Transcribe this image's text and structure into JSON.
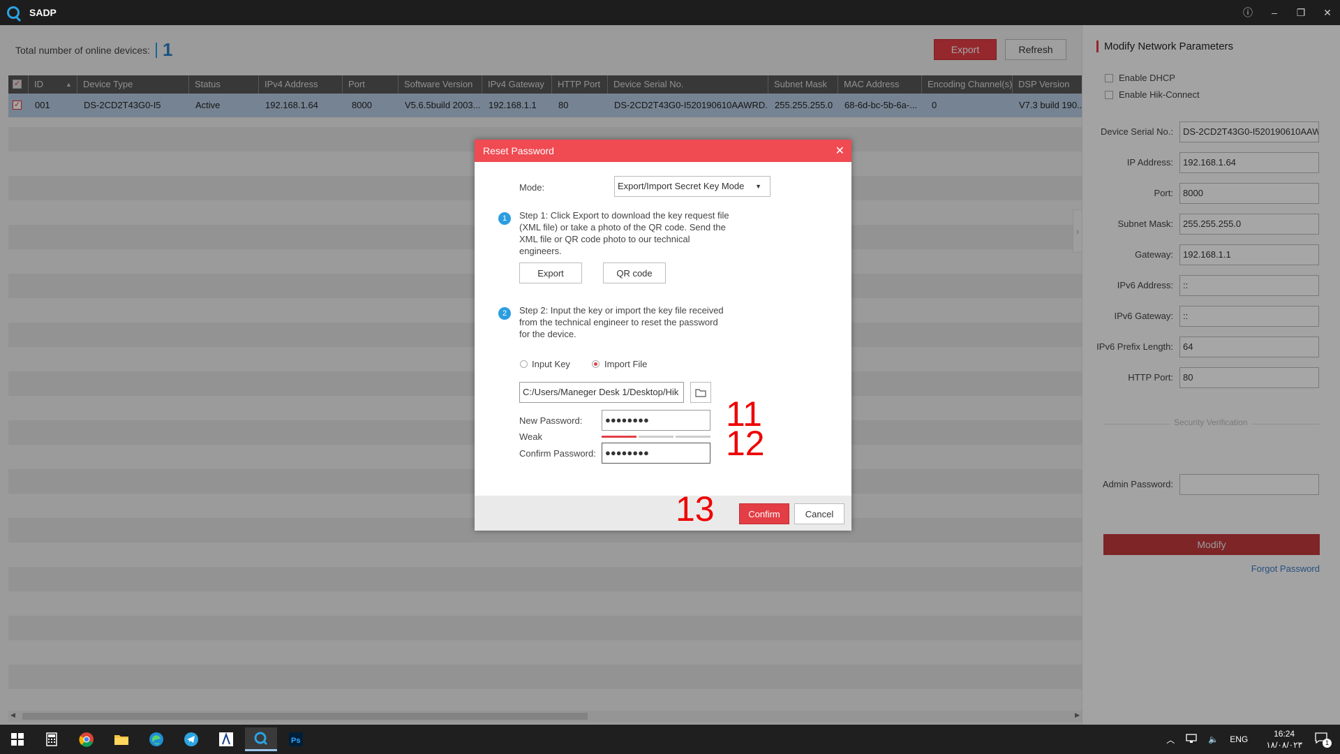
{
  "app": {
    "title": "SADP"
  },
  "window_controls": {
    "info": "ⓘ",
    "minimize": "–",
    "restore": "❐",
    "close": "✕"
  },
  "topbar": {
    "online_label": "Total number of online devices:",
    "online_count": "1",
    "export_label": "Export",
    "refresh_label": "Refresh"
  },
  "table": {
    "headers": [
      "ID",
      "Device Type",
      "Status",
      "IPv4 Address",
      "Port",
      "Software Version",
      "IPv4 Gateway",
      "HTTP Port",
      "Device Serial No.",
      "Subnet Mask",
      "MAC Address",
      "Encoding Channel(s)",
      "DSP Version"
    ],
    "row": [
      "001",
      "DS-2CD2T43G0-I5",
      "Active",
      "192.168.1.64",
      "8000",
      "V5.6.5build 2003...",
      "192.168.1.1",
      "80",
      "DS-2CD2T43G0-I520190610AAWRD...",
      "255.255.255.0",
      "68-6d-bc-5b-6a-...",
      "0",
      "V7.3 build 190..."
    ]
  },
  "side": {
    "title": "Modify Network Parameters",
    "enable_dhcp": "Enable DHCP",
    "enable_hik": "Enable Hik-Connect",
    "fields": [
      {
        "label": "Device Serial No.:",
        "value": "DS-2CD2T43G0-I520190610AAWR"
      },
      {
        "label": "IP Address:",
        "value": "192.168.1.64"
      },
      {
        "label": "Port:",
        "value": "8000"
      },
      {
        "label": "Subnet Mask:",
        "value": "255.255.255.0"
      },
      {
        "label": "Gateway:",
        "value": "192.168.1.1"
      },
      {
        "label": "IPv6 Address:",
        "value": "::"
      },
      {
        "label": "IPv6 Gateway:",
        "value": "::"
      },
      {
        "label": "IPv6 Prefix Length:",
        "value": "64"
      },
      {
        "label": "HTTP Port:",
        "value": "80"
      }
    ],
    "security": "Security Verification",
    "admin_label": "Admin Password:",
    "admin_value": "",
    "modify": "Modify",
    "forgot": "Forgot Password"
  },
  "dialog": {
    "title": "Reset Password",
    "mode_label": "Mode:",
    "mode_value": "Export/Import Secret Key Mode",
    "step1_num": "1",
    "step1_lines": [
      "Step 1: Click Export to download the key request file",
      "(XML file) or take a photo of the QR code. Send the",
      "XML file or QR code photo to our technical",
      "engineers."
    ],
    "export": "Export",
    "qr": "QR code",
    "step2_num": "2",
    "step2_lines": [
      "Step 2: Input the key or import the key file received",
      "from the technical engineer to reset the password",
      "for the device."
    ],
    "input_key": "Input Key",
    "import_file": "Import File",
    "file_path": "C:/Users/Maneger Desk 1/Desktop/Hik",
    "new_pw_label": "New Password:",
    "new_pw_value": "●●●●●●●●",
    "strength": "Weak",
    "strength_level": 0.33,
    "confirm_pw_label": "Confirm Password:",
    "confirm_pw_value": "●●●●●●●●",
    "confirm": "Confirm",
    "cancel": "Cancel"
  },
  "annotations": {
    "a11": "11",
    "a12": "12",
    "a13": "13"
  },
  "taskbar": {
    "lang": "ENG",
    "time": "16:24",
    "date": "۱۸/۰۸/۰۲۳",
    "notif": "1"
  },
  "colors": {
    "accent_red": "#e33e46",
    "header_red": "#f04a52",
    "selected_row": "#b5cae1"
  }
}
